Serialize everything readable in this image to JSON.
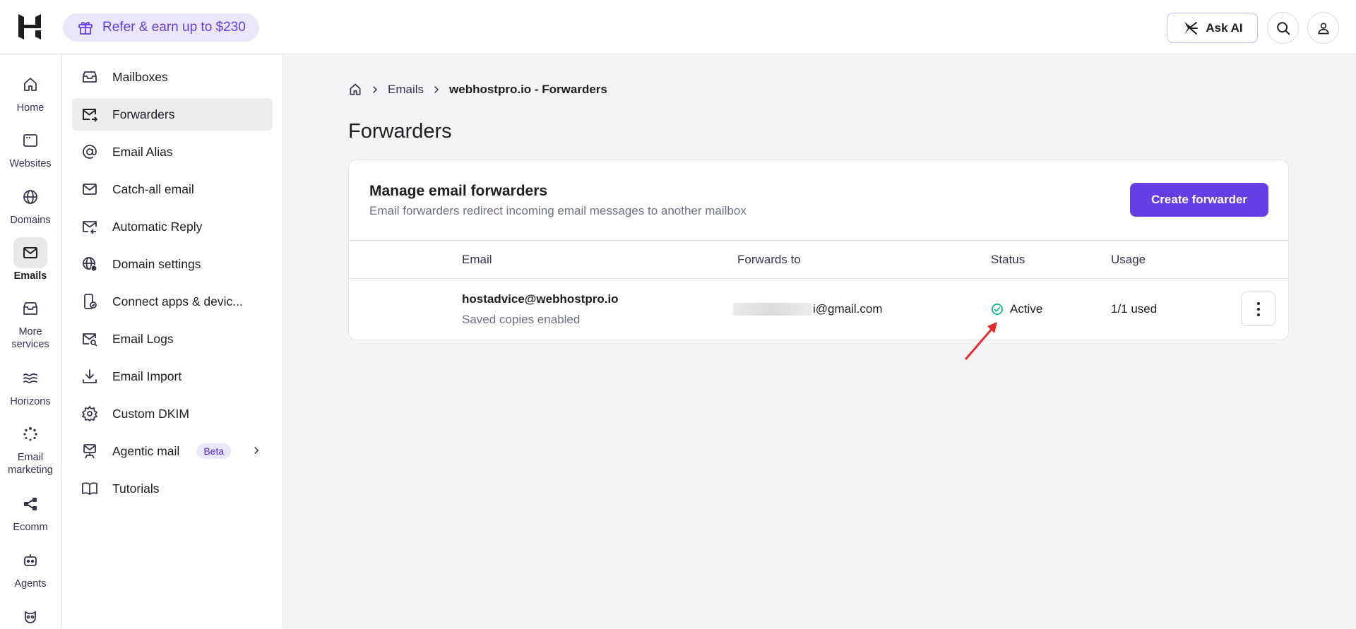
{
  "topbar": {
    "refer_label": "Refer & earn up to $230",
    "ask_ai_label": "Ask AI"
  },
  "rail": {
    "items": [
      {
        "label": "Home",
        "icon": "home-icon"
      },
      {
        "label": "Websites",
        "icon": "browser-icon"
      },
      {
        "label": "Domains",
        "icon": "globe-icon"
      },
      {
        "label": "Emails",
        "icon": "envelope-icon",
        "active": true
      },
      {
        "label": "More services",
        "icon": "inbox-tray-icon"
      },
      {
        "label": "Horizons",
        "icon": "waves-icon"
      },
      {
        "label": "Email marketing",
        "icon": "spinner-icon"
      },
      {
        "label": "Ecomm",
        "icon": "share-nodes-icon"
      },
      {
        "label": "Agents",
        "icon": "robot-icon"
      }
    ]
  },
  "sidebar": {
    "items": [
      {
        "label": "Mailboxes",
        "icon": "inbox-icon"
      },
      {
        "label": "Forwarders",
        "icon": "mail-forward-icon",
        "active": true
      },
      {
        "label": "Email Alias",
        "icon": "at-sign-icon"
      },
      {
        "label": "Catch-all email",
        "icon": "envelope-icon"
      },
      {
        "label": "Automatic Reply",
        "icon": "mail-reply-icon"
      },
      {
        "label": "Domain settings",
        "icon": "globe-gear-icon"
      },
      {
        "label": "Connect apps & devic...",
        "icon": "device-connect-icon"
      },
      {
        "label": "Email Logs",
        "icon": "mail-search-icon"
      },
      {
        "label": "Email Import",
        "icon": "download-icon"
      },
      {
        "label": "Custom DKIM",
        "icon": "gear-icon"
      },
      {
        "label": "Agentic mail",
        "icon": "mail-agent-icon",
        "badge": "Beta"
      },
      {
        "label": "Tutorials",
        "icon": "book-icon"
      }
    ]
  },
  "breadcrumb": {
    "parent": "Emails",
    "current": "webhostpro.io - Forwarders"
  },
  "page": {
    "title": "Forwarders"
  },
  "card": {
    "title": "Manage email forwarders",
    "subtitle": "Email forwarders redirect incoming email messages to another mailbox",
    "create_label": "Create forwarder"
  },
  "table": {
    "columns": [
      "Email",
      "Forwards to",
      "Status",
      "Usage"
    ],
    "rows": [
      {
        "email": "hostadvice@webhostpro.io",
        "note": "Saved copies enabled",
        "forwards_to_visible": "i@gmail.com",
        "status": "Active",
        "usage": "1/1 used"
      }
    ]
  },
  "colors": {
    "accent": "#673de6",
    "status_active": "#00b090",
    "annotation_arrow": "#e8292a"
  }
}
